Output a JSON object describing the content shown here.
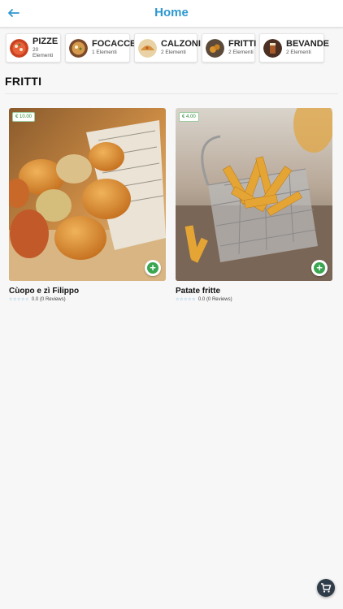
{
  "header": {
    "title": "Home",
    "back_icon": "arrow-left-icon",
    "accent": "#2e97d0"
  },
  "categories": [
    {
      "name": "PIZZE",
      "count": "20 Elementi",
      "icon": "pizza-thumb"
    },
    {
      "name": "FOCACCE",
      "count": "1 Elementi",
      "icon": "focaccia-thumb"
    },
    {
      "name": "CALZONI",
      "count": "2 Elementi",
      "icon": "calzone-thumb"
    },
    {
      "name": "FRITTI",
      "count": "2 Elementi",
      "icon": "fried-thumb"
    },
    {
      "name": "BEVANDE",
      "count": "2 Elementi",
      "icon": "drink-thumb"
    }
  ],
  "section": {
    "title": "FRITTI"
  },
  "products": [
    {
      "name": "Cùopo e zì Filippo",
      "price": "€ 10.00",
      "rating": "0.0",
      "reviews": "(0 Reviews)",
      "stars": 0
    },
    {
      "name": "Patate fritte",
      "price": "€ 4.00",
      "rating": "0.0",
      "reviews": "(0 Reviews)",
      "stars": 0
    }
  ],
  "cart": {
    "icon": "cart-icon"
  },
  "colors": {
    "add_button": "#3aa651",
    "price_text": "#2e8b3a",
    "star": "#3b9ad6",
    "cart_bg": "#2f3d4a"
  }
}
